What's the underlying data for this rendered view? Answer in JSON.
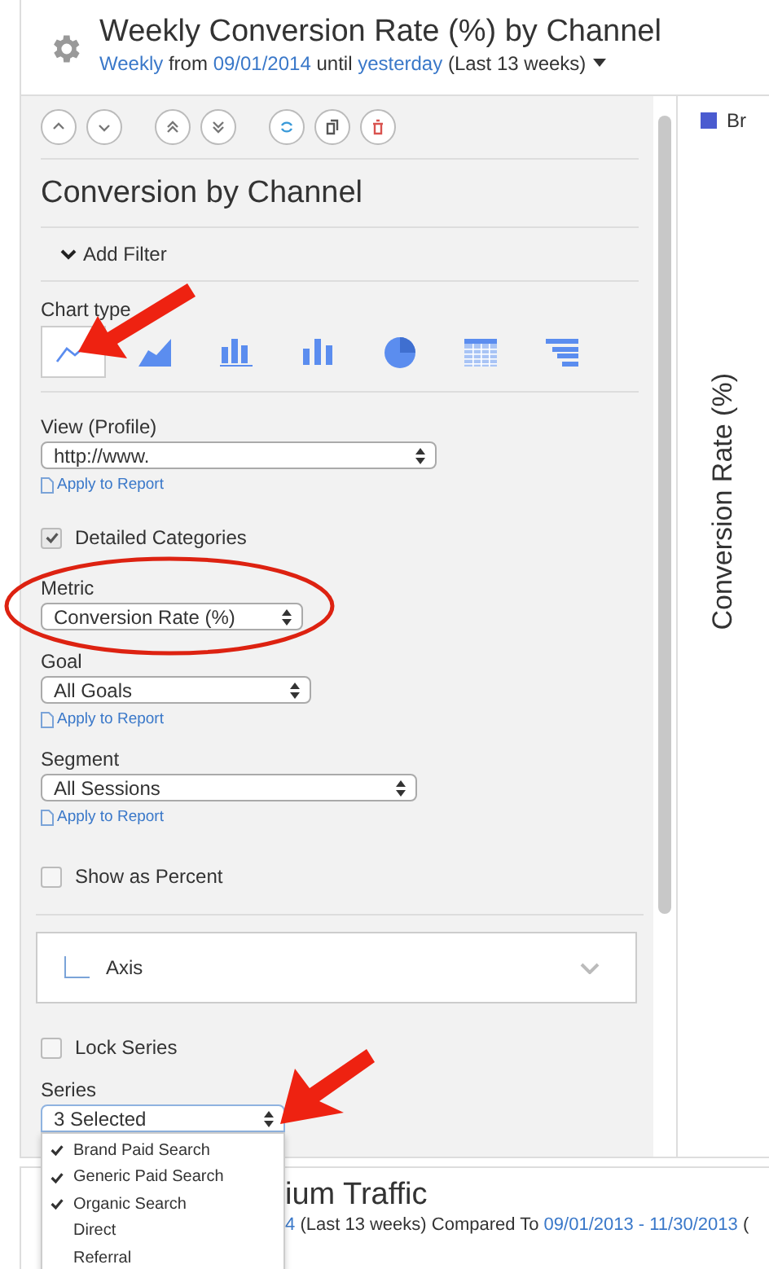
{
  "report": {
    "title": "Weekly Conversion Rate (%) by Channel",
    "subtitle": [
      {
        "kind": "link",
        "text": "Weekly"
      },
      {
        "kind": "plain",
        "text": "from"
      },
      {
        "kind": "link",
        "text": "09/01/2014"
      },
      {
        "kind": "plain",
        "text": "until"
      },
      {
        "kind": "link",
        "text": "yesterday"
      },
      {
        "kind": "plain",
        "text": "(Last 13 weeks)"
      }
    ]
  },
  "panel": {
    "title": "Conversion by Channel",
    "filter": "Add Filter",
    "chart_type_label": "Chart type",
    "chart_types": [
      {
        "kind": "line",
        "selected": true
      },
      {
        "kind": "area",
        "selected": false
      },
      {
        "kind": "grouped-bar",
        "selected": false
      },
      {
        "kind": "bar",
        "selected": false
      },
      {
        "kind": "pie",
        "selected": false
      },
      {
        "kind": "table",
        "selected": false
      },
      {
        "kind": "funnel",
        "selected": false
      }
    ],
    "controls": [
      {
        "kind": "select",
        "label": "View (Profile)",
        "value": "http://www.",
        "apply": "Apply to Report"
      },
      {
        "kind": "checkbox",
        "label": "Detailed Categories",
        "checked": true
      },
      {
        "kind": "select",
        "label": "Metric",
        "value": "Conversion Rate (%)"
      },
      {
        "kind": "select",
        "label": "Goal",
        "value": "All Goals",
        "apply": "Apply to Report"
      },
      {
        "kind": "select",
        "label": "Segment",
        "value": "All Sessions",
        "apply": "Apply to Report"
      },
      {
        "kind": "checkbox",
        "label": "Show as Percent",
        "checked": false
      },
      {
        "kind": "section",
        "label": "Axis",
        "expanded": false
      },
      {
        "kind": "checkbox",
        "label": "Lock Series",
        "checked": false
      },
      {
        "kind": "select",
        "label": "Series",
        "value": "3 Selected",
        "open": true,
        "options": [
          {
            "label": "Brand Paid Search",
            "checked": true
          },
          {
            "label": "Generic Paid Search",
            "checked": true
          },
          {
            "label": "Organic Search",
            "checked": true
          },
          {
            "label": "Direct",
            "checked": false
          },
          {
            "label": "Referral",
            "checked": false
          }
        ]
      }
    ]
  },
  "chart": {
    "legend": [
      {
        "label": "Br",
        "color": "#4a5bd0"
      }
    ],
    "ylabel": "Conversion Rate (%)"
  },
  "next_report": {
    "title": "ium Traffic",
    "subtitle": [
      {
        "kind": "link",
        "text": "4"
      },
      {
        "kind": "plain",
        "text": "(Last 13 weeks) Compared To"
      },
      {
        "kind": "link",
        "text": "09/01/2013 - 11/30/2013"
      },
      {
        "kind": "plain",
        "text": "("
      }
    ]
  }
}
